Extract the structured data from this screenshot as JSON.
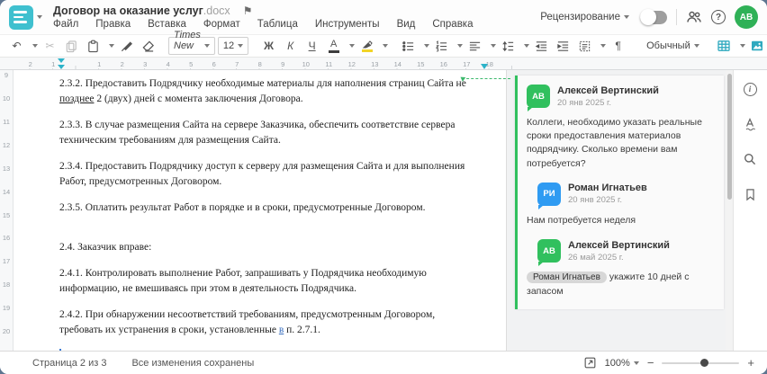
{
  "header": {
    "title": "Договор на оказание услуг",
    "ext": ".docx",
    "avatar_initials": "АВ",
    "menu": [
      "Файл",
      "Правка",
      "Вставка",
      "Формат",
      "Таблица",
      "Инструменты",
      "Вид",
      "Справка"
    ],
    "review_label": "Рецензирование"
  },
  "icons": {
    "flag": "⚑",
    "undo": "↶",
    "scissors": "✂",
    "pilcrow": "¶",
    "more": "•••",
    "question": "?",
    "info": "i",
    "minus": "−",
    "plus": "+"
  },
  "toolbar": {
    "font_name": "Times New ...",
    "font_size": "12",
    "bold": "Ж",
    "italic": "К",
    "underline": "Ч",
    "font_color_letter": "А",
    "style_name": "Обычный"
  },
  "ruler": {
    "h": [
      "2",
      "1",
      "",
      "1",
      "2",
      "3",
      "4",
      "5",
      "6",
      "7",
      "8",
      "9",
      "10",
      "11",
      "12",
      "13",
      "14",
      "15",
      "16",
      "17",
      "18"
    ],
    "v": [
      "9",
      "10",
      "11",
      "12",
      "13",
      "14",
      "15",
      "16",
      "17",
      "18",
      "19",
      "20"
    ]
  },
  "document": {
    "paragraphs": [
      {
        "t1": "2.3.2. Предоставить Подрядчику необходимые материалы для наполнения страниц Сайта не ",
        "u": "позднее",
        "t2": " 2 (двух) дней с момента заключения Договора."
      },
      {
        "t1": "2.3.3. В случае размещения Сайта на сервере Заказчика, обеспечить соответствие сервера техническим требованиям для размещения Сайта."
      },
      {
        "t1": "2.3.4. Предоставить Подрядчику доступ к серверу для размещения Сайта и для выполнения Работ, предусмотренных Договором."
      },
      {
        "t1": "2.3.5. Оплатить результат Работ в порядке и в сроки, предусмотренные Договором."
      },
      {
        "t1": "2.4. Заказчик вправе:"
      },
      {
        "t1": "2.4.1. Контролировать выполнение Работ, запрашивать у Подрядчика необходимую информацию, не вмешиваясь при этом в деятельность Подрядчика."
      },
      {
        "t1": "2.4.2. При обнаружении несоответствий требованиям, предусмотренным Договором, требовать их устранения в сроки, установленные ",
        "u2": "в",
        "t2": " п. 2.7.1."
      }
    ]
  },
  "comments": {
    "thread": {
      "root": {
        "initials": "АВ",
        "name": "Алексей Вертинский",
        "date": "20 янв 2025 г.",
        "text": "Коллеги, необходимо указать реальные сроки предоставления материалов подрядчику. Сколько времени вам потребуется?"
      },
      "reply1": {
        "initials": "РИ",
        "name": "Роман Игнатьев",
        "date": "20 янв 2025 г.",
        "text": "Нам потребуется неделя"
      },
      "reply2": {
        "initials": "АВ",
        "name": "Алексей Вертинский",
        "date": "26 май 2025 г.",
        "mention": "Роман Игнатьев",
        "text": " укажите 10 дней с запасом"
      }
    }
  },
  "status_bar": {
    "page": "Страница 2 из 3",
    "saved": "Все изменения сохранены",
    "zoom": "100%"
  },
  "colors": {
    "accent_teal": "#3fc0cf",
    "comment_green": "#31c05e",
    "reply_blue": "#2f9bf2"
  }
}
